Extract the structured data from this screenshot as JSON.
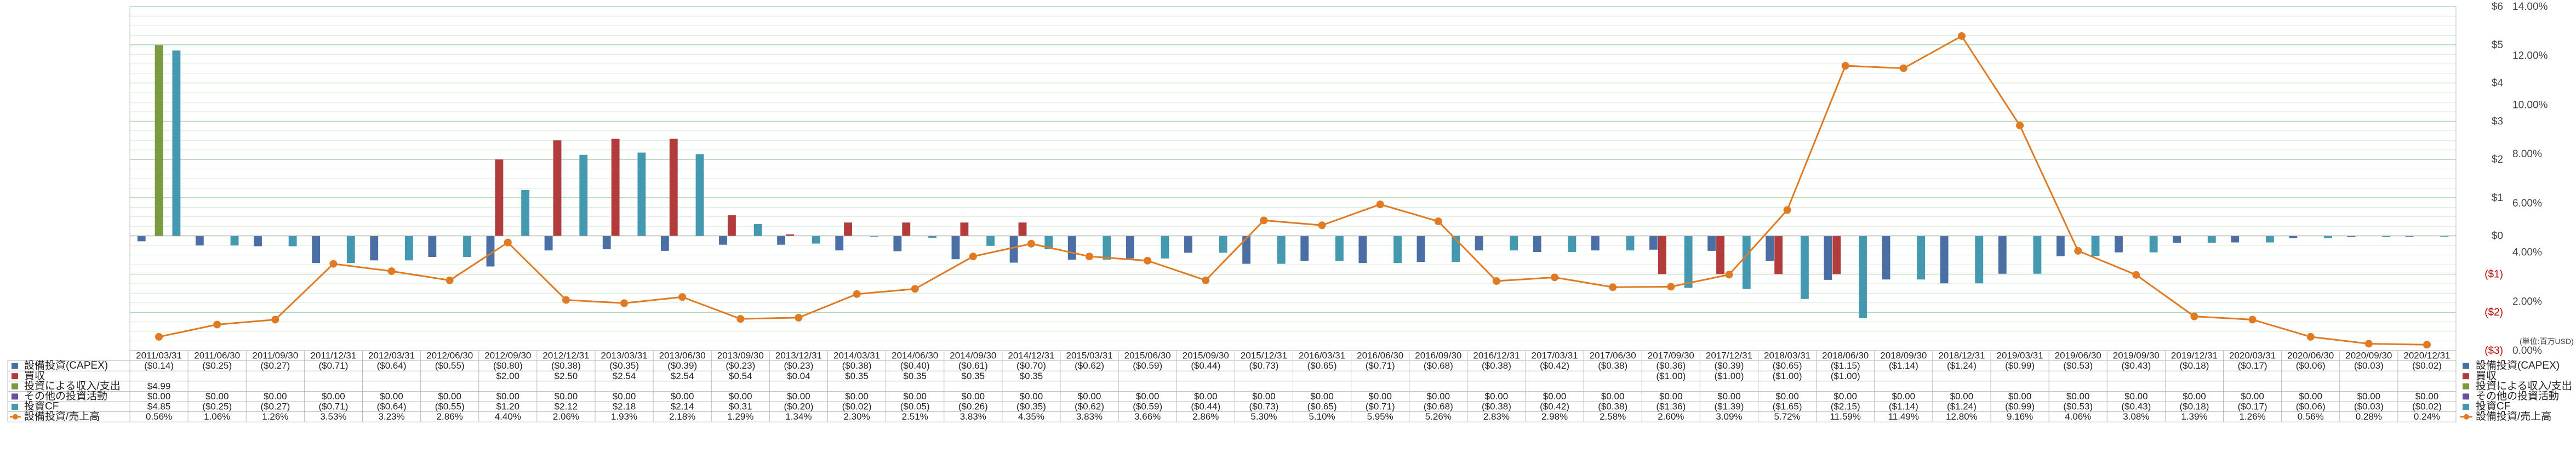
{
  "chart_data": {
    "type": "bar",
    "y_unit_note": "(単位:百万USD)",
    "ylim_left": [
      -3,
      6
    ],
    "ylim_right": [
      0,
      14
    ],
    "left_ticks": [
      "$6",
      "$5",
      "$4",
      "$3",
      "$2",
      "$1",
      "$0",
      "($1)",
      "($2)",
      "($3)"
    ],
    "left_tick_values": [
      6,
      5,
      4,
      3,
      2,
      1,
      0,
      -1,
      -2,
      -3
    ],
    "right_ticks": [
      "14.00%",
      "12.00%",
      "10.00%",
      "8.00%",
      "6.00%",
      "4.00%",
      "2.00%",
      "0.00%"
    ],
    "right_tick_values": [
      14,
      12,
      10,
      8,
      6,
      4,
      2,
      0
    ],
    "grid": true,
    "legend_position": "right",
    "categories": [
      "2011/03/31",
      "2011/06/30",
      "2011/09/30",
      "2011/12/31",
      "2012/03/31",
      "2012/06/30",
      "2012/09/30",
      "2012/12/31",
      "2013/03/31",
      "2013/06/30",
      "2013/09/30",
      "2013/12/31",
      "2014/03/31",
      "2014/06/30",
      "2014/09/30",
      "2014/12/31",
      "2015/03/31",
      "2015/06/30",
      "2015/09/30",
      "2015/12/31",
      "2016/03/31",
      "2016/06/30",
      "2016/09/30",
      "2016/12/31",
      "2017/03/31",
      "2017/06/30",
      "2017/09/30",
      "2017/12/31",
      "2018/03/31",
      "2018/06/30",
      "2018/09/30",
      "2018/12/31",
      "2019/03/31",
      "2019/06/30",
      "2019/09/30",
      "2019/12/31",
      "2020/03/31",
      "2020/06/30",
      "2020/09/30",
      "2020/12/31"
    ],
    "series": [
      {
        "name": "設備投資(CAPEX)",
        "kind": "bar",
        "color": "#4a6fa5",
        "values": [
          -0.14,
          -0.25,
          -0.27,
          -0.71,
          -0.64,
          -0.55,
          -0.8,
          -0.38,
          -0.35,
          -0.39,
          -0.23,
          -0.23,
          -0.38,
          -0.4,
          -0.61,
          -0.7,
          -0.62,
          -0.59,
          -0.44,
          -0.73,
          -0.65,
          -0.71,
          -0.68,
          -0.38,
          -0.42,
          -0.38,
          -0.36,
          -0.39,
          -0.65,
          -1.15,
          -1.14,
          -1.24,
          -0.99,
          -0.53,
          -0.43,
          -0.18,
          -0.17,
          -0.06,
          -0.03,
          -0.02
        ],
        "labels": [
          "($0.14)",
          "($0.25)",
          "($0.27)",
          "($0.71)",
          "($0.64)",
          "($0.55)",
          "($0.80)",
          "($0.38)",
          "($0.35)",
          "($0.39)",
          "($0.23)",
          "($0.23)",
          "($0.38)",
          "($0.40)",
          "($0.61)",
          "($0.70)",
          "($0.62)",
          "($0.59)",
          "($0.44)",
          "($0.73)",
          "($0.65)",
          "($0.71)",
          "($0.68)",
          "($0.38)",
          "($0.42)",
          "($0.38)",
          "($0.36)",
          "($0.39)",
          "($0.65)",
          "($1.15)",
          "($1.14)",
          "($1.24)",
          "($0.99)",
          "($0.53)",
          "($0.43)",
          "($0.18)",
          "($0.17)",
          "($0.06)",
          "($0.03)",
          "($0.02)"
        ]
      },
      {
        "name": "買収",
        "kind": "bar",
        "color": "#b23b3b",
        "values": [
          null,
          null,
          null,
          null,
          null,
          null,
          2.0,
          2.5,
          2.54,
          2.54,
          0.54,
          0.04,
          0.35,
          0.35,
          0.35,
          0.35,
          null,
          null,
          null,
          null,
          null,
          null,
          null,
          null,
          null,
          null,
          -1.0,
          -1.0,
          -1.0,
          -1.0,
          null,
          null,
          null,
          null,
          null,
          null,
          null,
          null,
          null,
          null
        ],
        "labels": [
          "",
          "",
          "",
          "",
          "",
          "",
          "$2.00",
          "$2.50",
          "$2.54",
          "$2.54",
          "$0.54",
          "$0.04",
          "$0.35",
          "$0.35",
          "$0.35",
          "$0.35",
          "",
          "",
          "",
          "",
          "",
          "",
          "",
          "",
          "",
          "",
          "($1.00)",
          "($1.00)",
          "($1.00)",
          "($1.00)",
          "",
          "",
          "",
          "",
          "",
          "",
          "",
          "",
          "",
          ""
        ]
      },
      {
        "name": "投資による収入/支出",
        "kind": "bar",
        "color": "#7a9c3e",
        "values": [
          4.99,
          null,
          null,
          null,
          null,
          null,
          null,
          null,
          null,
          null,
          null,
          null,
          null,
          null,
          null,
          null,
          null,
          null,
          null,
          null,
          null,
          null,
          null,
          null,
          null,
          null,
          null,
          null,
          null,
          null,
          null,
          null,
          null,
          null,
          null,
          null,
          null,
          null,
          null,
          null
        ],
        "labels": [
          "$4.99",
          "",
          "",
          "",
          "",
          "",
          "",
          "",
          "",
          "",
          "",
          "",
          "",
          "",
          "",
          "",
          "",
          "",
          "",
          "",
          "",
          "",
          "",
          "",
          "",
          "",
          "",
          "",
          "",
          "",
          "",
          "",
          "",
          "",
          "",
          "",
          "",
          "",
          "",
          ""
        ]
      },
      {
        "name": "その他の投資活動",
        "kind": "bar",
        "color": "#6b4f9a",
        "values": [
          0,
          0,
          0,
          0,
          0,
          0,
          0,
          0,
          0,
          0,
          0,
          0,
          0,
          0,
          0,
          0,
          0,
          0,
          0,
          0,
          0,
          0,
          0,
          0,
          0,
          0,
          0,
          0,
          0,
          0,
          0,
          0,
          0,
          0,
          0,
          0,
          0,
          0,
          0,
          0
        ],
        "labels": [
          "$0.00",
          "$0.00",
          "$0.00",
          "$0.00",
          "$0.00",
          "$0.00",
          "$0.00",
          "$0.00",
          "$0.00",
          "$0.00",
          "$0.00",
          "$0.00",
          "$0.00",
          "$0.00",
          "$0.00",
          "$0.00",
          "$0.00",
          "$0.00",
          "$0.00",
          "$0.00",
          "$0.00",
          "$0.00",
          "$0.00",
          "$0.00",
          "$0.00",
          "$0.00",
          "$0.00",
          "$0.00",
          "$0.00",
          "$0.00",
          "$0.00",
          "$0.00",
          "$0.00",
          "$0.00",
          "$0.00",
          "$0.00",
          "$0.00",
          "$0.00",
          "$0.00",
          "$0.00"
        ]
      },
      {
        "name": "投資CF",
        "kind": "bar",
        "color": "#4499b0",
        "values": [
          4.85,
          -0.25,
          -0.27,
          -0.71,
          -0.64,
          -0.55,
          1.2,
          2.12,
          2.18,
          2.14,
          0.31,
          -0.2,
          -0.02,
          -0.05,
          -0.26,
          -0.35,
          -0.62,
          -0.59,
          -0.44,
          -0.73,
          -0.65,
          -0.71,
          -0.68,
          -0.38,
          -0.42,
          -0.38,
          -1.36,
          -1.39,
          -1.65,
          -2.15,
          -1.14,
          -1.24,
          -0.99,
          -0.53,
          -0.43,
          -0.18,
          -0.17,
          -0.06,
          -0.03,
          -0.02
        ],
        "labels": [
          "$4.85",
          "($0.25)",
          "($0.27)",
          "($0.71)",
          "($0.64)",
          "($0.55)",
          "$1.20",
          "$2.12",
          "$2.18",
          "$2.14",
          "$0.31",
          "($0.20)",
          "($0.02)",
          "($0.05)",
          "($0.26)",
          "($0.35)",
          "($0.62)",
          "($0.59)",
          "($0.44)",
          "($0.73)",
          "($0.65)",
          "($0.71)",
          "($0.68)",
          "($0.38)",
          "($0.42)",
          "($0.38)",
          "($1.36)",
          "($1.39)",
          "($1.65)",
          "($2.15)",
          "($1.14)",
          "($1.24)",
          "($0.99)",
          "($0.53)",
          "($0.43)",
          "($0.18)",
          "($0.17)",
          "($0.06)",
          "($0.03)",
          "($0.02)"
        ]
      },
      {
        "name": "設備投資/売上高",
        "kind": "line",
        "axis": "right",
        "color": "#e07b24",
        "values": [
          0.56,
          1.06,
          1.26,
          3.53,
          3.23,
          2.86,
          4.4,
          2.06,
          1.93,
          2.18,
          1.29,
          1.34,
          2.3,
          2.51,
          3.83,
          4.35,
          3.83,
          3.66,
          2.86,
          5.3,
          5.1,
          5.95,
          5.26,
          2.83,
          2.98,
          2.58,
          2.6,
          3.09,
          5.72,
          11.59,
          11.49,
          12.8,
          9.16,
          4.06,
          3.08,
          1.39,
          1.26,
          0.56,
          0.28,
          0.24
        ],
        "labels": [
          "0.56%",
          "1.06%",
          "1.26%",
          "3.53%",
          "3.23%",
          "2.86%",
          "4.40%",
          "2.06%",
          "1.93%",
          "2.18%",
          "1.29%",
          "1.34%",
          "2.30%",
          "2.51%",
          "3.83%",
          "4.35%",
          "3.83%",
          "3.66%",
          "2.86%",
          "5.30%",
          "5.10%",
          "5.95%",
          "5.26%",
          "2.83%",
          "2.98%",
          "2.58%",
          "2.60%",
          "3.09%",
          "5.72%",
          "11.59%",
          "11.49%",
          "12.80%",
          "9.16%",
          "4.06%",
          "3.08%",
          "1.39%",
          "1.26%",
          "0.56%",
          "0.28%",
          "0.24%"
        ]
      }
    ]
  }
}
